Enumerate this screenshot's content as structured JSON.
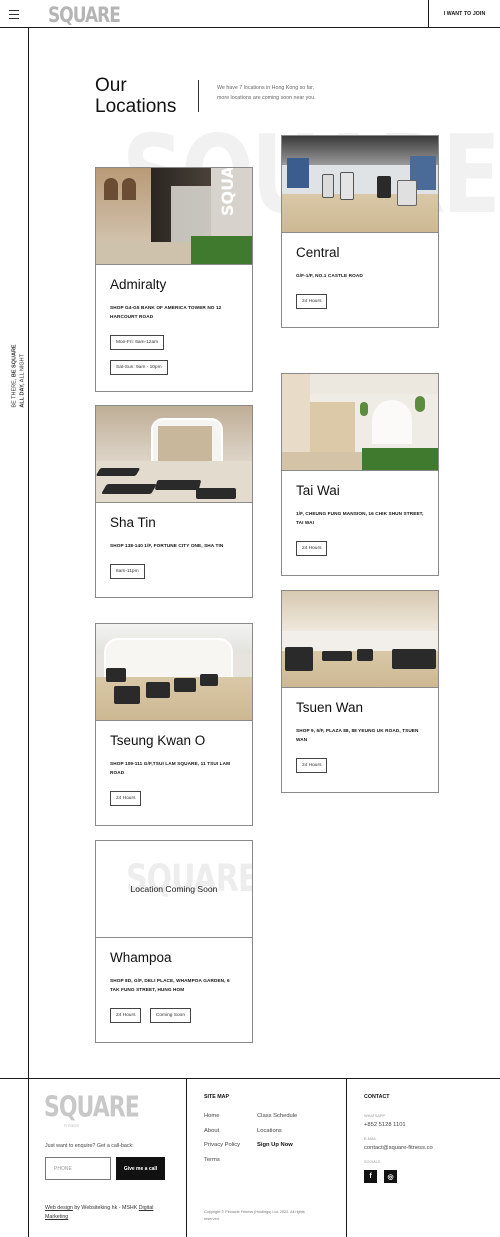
{
  "header": {
    "logo": "SQUARE",
    "join_label": "I WANT TO JOIN"
  },
  "side_rail": {
    "line1": "BE THERE, ",
    "line1_bold": "BE SQUARE",
    "line2_bold": "ALL DAY,",
    "line2": " ALL NIGHT"
  },
  "page": {
    "title_line1": "Our",
    "title_line2": "Locations",
    "intro": "We have 7 locations in Hong Kong so far, more locations are coming soon near you.",
    "bg_word": "SQUARE"
  },
  "locations": [
    {
      "name": "Admiralty",
      "address": "SHOP G4-G5 BANK OF AMERICA TOWER NO 12 HARCOURT ROAD",
      "hours": [
        "Mon-Fri: 6am-12am",
        "Sat-Sun: 9am - 10pm"
      ]
    },
    {
      "name": "Central",
      "address": "G/F-1/F, NO.1 CASTLE ROAD",
      "hours": [
        "24 Hours"
      ]
    },
    {
      "name": "Sha Tin",
      "address": "SHOP 138-140 1/F, FORTUNE CITY ONE, SHA TIN",
      "hours": [
        "6am-11pm"
      ]
    },
    {
      "name": "Tai Wai",
      "address": "1/F, CHEUNG FUNG MANSION, 16 CHIK SHUN STREET, TAI WAI",
      "hours": [
        "24 Hours"
      ]
    },
    {
      "name": "Tseung Kwan O",
      "address": "SHOP 109-111 G/F,TSUI LAM SQUARE, 11 TSUI LAM ROAD",
      "hours": [
        "24 Hours"
      ]
    },
    {
      "name": "Tsuen Wan",
      "address": "SHOP 9, 6/F, PLAZA 88, 88 YEUNG UK ROAD, TSUEN WAN",
      "hours": [
        "24 Hours"
      ]
    },
    {
      "name": "Whampoa",
      "address": "SHOP 8D, G/F, DELI PLACE, WHAMPOA GARDEN, 6 TAK FUNG STREET, HUNG HOM",
      "hours": [
        "24 Hours",
        "Coming Soon"
      ],
      "placeholder": "Location Coming Soon",
      "placeholder_bg": "SQUARE"
    }
  ],
  "footer": {
    "logo": "SQUARE",
    "logo_sub": "FITNESS",
    "enquire": "Just want to enquire? Get a call-back:",
    "phone_placeholder": "PHONE",
    "call_button": "Give me a call",
    "credit_link": "Web design",
    "credit_mid": " by Websiteking hk - MSHK ",
    "credit_link2": "Digital Marketing",
    "sitemap_title": "SITE MAP",
    "sitemap_col1": [
      "Home",
      "About",
      "Privacy Policy",
      "Terms"
    ],
    "sitemap_col2": [
      "Class Schedule",
      "Locations",
      "Sign Up Now"
    ],
    "copyright": "Copyright © Pinnacle Fitness (Holdings) Ltd. 2022. All rights reserved.",
    "contact_title": "CONTACT",
    "whatsapp_label": "WHATSAPP",
    "whatsapp": "+852 5128 1101",
    "email_label": "E-MAIL",
    "email": "contact@square-fitness.co",
    "socials_label": "SOCIALS",
    "socials": [
      "f",
      "◎"
    ]
  }
}
